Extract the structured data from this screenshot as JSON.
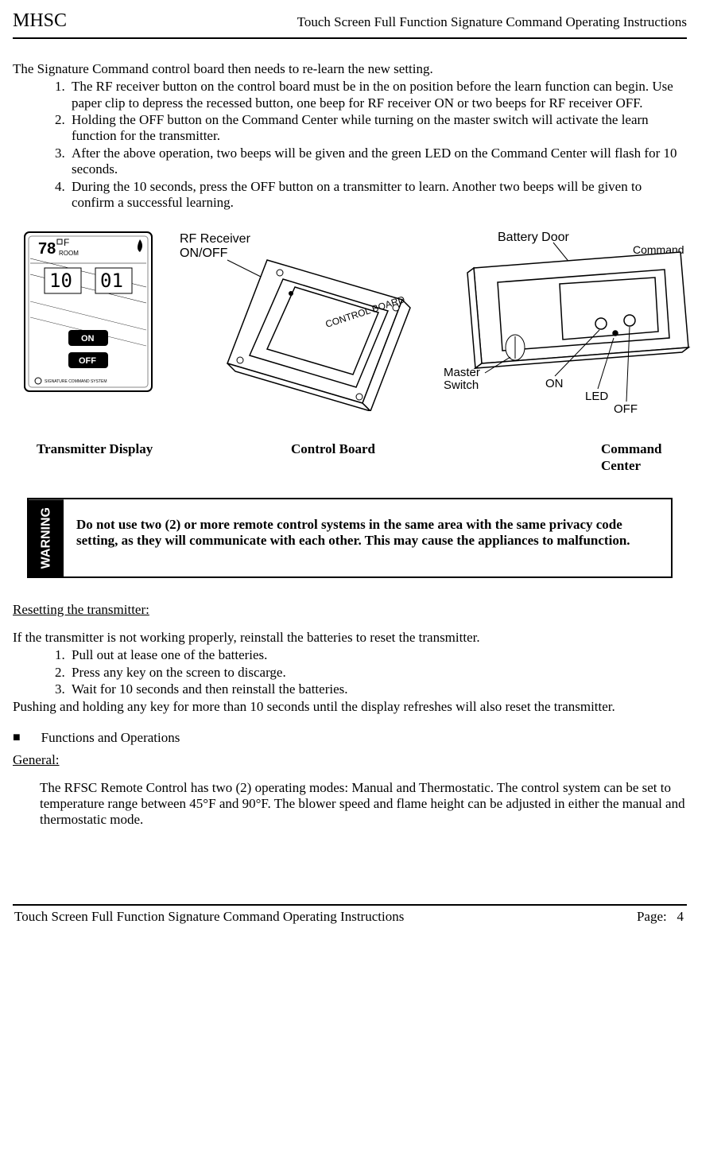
{
  "header": {
    "left": "MHSC",
    "right": "Touch Screen Full Function Signature Command Operating Instructions"
  },
  "intro": "The Signature Command control board then needs to re-learn the new setting.",
  "learn_steps": [
    "The RF receiver button on the control board must be in the on position before the learn function can begin. Use paper clip to depress the recessed button, one beep for RF receiver ON or two beeps for RF receiver OFF.",
    "Holding the OFF button on the Command Center while turning on the master switch will activate the learn function for the transmitter.",
    "After the above operation, two beeps will be given and the green LED on the Command Center will flash for 10 seconds.",
    "During the 10 seconds, press the OFF button on a transmitter to learn. Another two beeps will be given to confirm a successful learning."
  ],
  "figure_labels": {
    "rf_receiver": "RF Receiver",
    "on_off": "ON/OFF",
    "control_board": "CONTROL BOARD",
    "battery_door": "Battery Door",
    "command_center": "Command Center",
    "master_switch": "Master Switch",
    "on": "ON",
    "led": "LED",
    "off": "OFF",
    "txd_temp": "78",
    "txd_room": "ROOM",
    "txd_left": "10",
    "txd_right": "01",
    "txd_on": "ON",
    "txd_off": "OFF",
    "txd_brand": "SIGNATURE COMMAND SYSTEM"
  },
  "captions": {
    "c1": "Transmitter Display",
    "c2": "Control Board",
    "c3": "Command Center"
  },
  "warning": {
    "tab": "WARNING",
    "text": "Do not use two (2) or more remote control systems  in the same area with the same privacy code setting,  as they will communicate with each other.  This may cause the appliances to malfunction."
  },
  "reset": {
    "heading": "Resetting the transmitter:",
    "intro": "If the transmitter is not working properly, reinstall the batteries to reset the transmitter.",
    "steps": [
      "Pull out at lease one of the batteries.",
      "Press any key on the screen to discarge.",
      "Wait for 10 seconds and then reinstall the batteries."
    ],
    "outro": "Pushing and holding any key for more than 10 seconds until the display refreshes will also reset the transmitter."
  },
  "functions": {
    "bullet": "Functions and Operations",
    "general_heading": "General:",
    "general_text": "The RFSC Remote Control has two (2) operating modes: Manual and Thermostatic.  The control system can be set to temperature range between 45°F and 90°F.  The blower speed and flame height can be adjusted in either the manual and thermostatic mode."
  },
  "footer": {
    "left": "Touch Screen Full Function Signature Command Operating Instructions",
    "right_label": "Page:",
    "right_num": "4"
  }
}
